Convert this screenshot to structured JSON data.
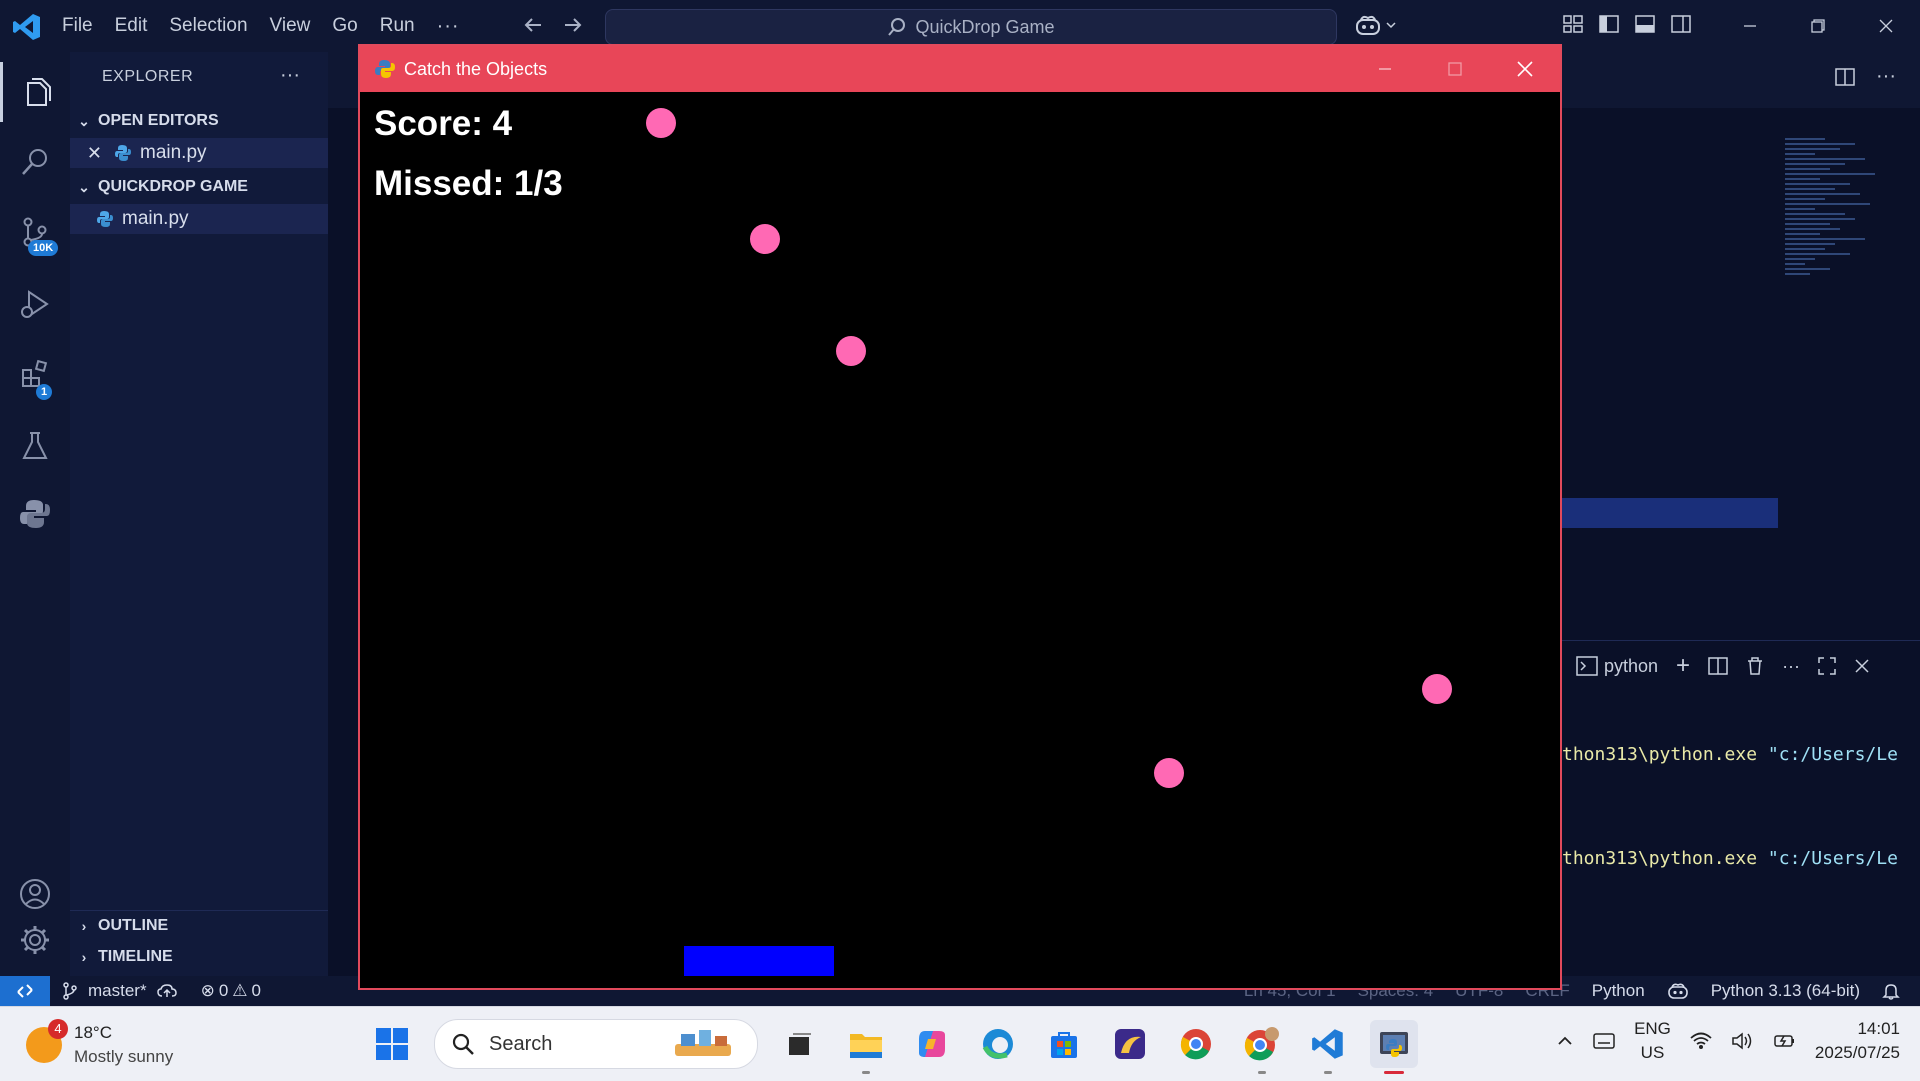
{
  "vscode": {
    "menu": [
      "File",
      "Edit",
      "Selection",
      "View",
      "Go",
      "Run"
    ],
    "menu_more": "···",
    "search_title": "QuickDrop Game",
    "sidebar": {
      "header": "EXPLORER",
      "header_more": "···",
      "open_editors_label": "OPEN EDITORS",
      "open_editor_file": "main.py",
      "project_label": "QUICKDROP GAME",
      "project_file": "main.py",
      "outline_label": "OUTLINE",
      "timeline_label": "TIMELINE"
    },
    "activity_badges": {
      "source_control": "10K",
      "extensions": "1"
    },
    "terminal": {
      "tab_label": "python",
      "lines": [
        {
          "path": "thon313\\python.exe ",
          "arg": "\"c:/Users/Le"
        },
        {
          "path": "thon313\\python.exe ",
          "arg": "\"c:/Users/Le"
        }
      ]
    },
    "statusbar": {
      "branch": "master*",
      "errors": "0",
      "warnings": "0",
      "cursor": "Ln 45, Col 1",
      "spaces": "Spaces: 4",
      "encoding": "UTF-8",
      "eol": "CRLF",
      "language": "Python",
      "interpreter": "Python 3.13 (64-bit)"
    }
  },
  "game_window": {
    "title": "Catch the Objects",
    "score_text": "Score: 4",
    "missed_text": "Missed: 1/3",
    "score": 4,
    "missed": 1,
    "max_missed": 3,
    "object_color": "#ff69b4",
    "paddle_color": "#0000ff",
    "background_color": "#000000",
    "titlebar_color": "#e84658"
  },
  "taskbar": {
    "weather_temp": "18°C",
    "weather_desc": "Mostly sunny",
    "weather_badge": "4",
    "search_placeholder": "Search",
    "lang_top": "ENG",
    "lang_bottom": "US",
    "time": "14:01",
    "date": "2025/07/25"
  }
}
